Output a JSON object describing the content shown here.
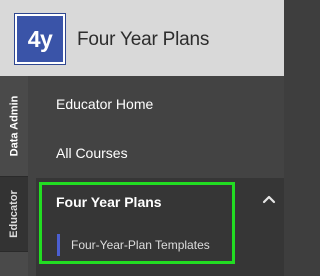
{
  "header": {
    "logo_text": "4y",
    "app_title": "Four Year Plans"
  },
  "rail": {
    "tabs": [
      {
        "label": "Data Admin"
      },
      {
        "label": "Educator"
      }
    ]
  },
  "nav": {
    "items": [
      {
        "label": "Educator Home"
      },
      {
        "label": "All Courses"
      }
    ],
    "section": {
      "title": "Four Year Plans",
      "icon": "chevron-up-icon",
      "items": [
        {
          "label": "Four-Year-Plan Templates"
        }
      ]
    }
  },
  "colors": {
    "brand": "#3a54a8",
    "focus_outline": "#22dd22",
    "active_marker": "#4b5fd1"
  }
}
